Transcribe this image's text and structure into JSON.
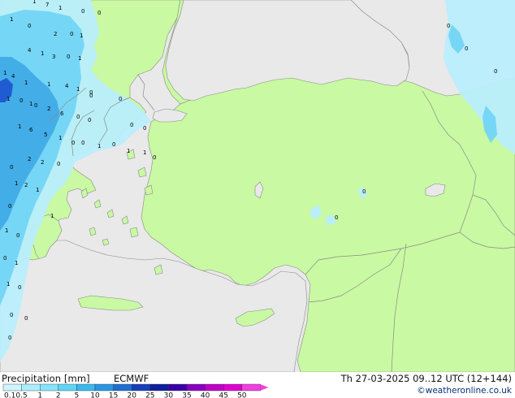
{
  "legend": {
    "title": "Precipitation [mm]",
    "model": "ECMWF",
    "valid_time": "Th 27-03-2025 09..12 UTC (12+144)",
    "credit": "©weatheronline.co.uk",
    "scale_ticks": [
      "0.1",
      "0.5",
      "1",
      "2",
      "5",
      "10",
      "15",
      "20",
      "25",
      "30",
      "35",
      "40",
      "45",
      "50"
    ],
    "scale_colors": [
      "#cff6ff",
      "#aaeeff",
      "#85e4fb",
      "#5fd4f5",
      "#3bb9ee",
      "#2a96e2",
      "#1e6fd2",
      "#163fbb",
      "#0d1f9a",
      "#3a00a8",
      "#8a00c0",
      "#c000c8",
      "#e000d0",
      "#f040e0"
    ]
  },
  "colors": {
    "sea": "#e9e9e9",
    "land": "#c9f9a2",
    "border": "#8a8a8a",
    "precip_light": "#b9eefc",
    "precip_mid": "#6fd3f5",
    "precip_heavy": "#3ea8e6",
    "precip_max": "#1f57d0"
  },
  "map": {
    "point_values": [
      {
        "text": "1"
      },
      {
        "text": "7"
      },
      {
        "text": "1"
      },
      {
        "text": "0"
      },
      {
        "text": "0"
      },
      {
        "text": "1"
      },
      {
        "text": "0"
      },
      {
        "text": "2"
      },
      {
        "text": "0"
      },
      {
        "text": "1"
      },
      {
        "text": "4"
      },
      {
        "text": "1"
      },
      {
        "text": "3"
      },
      {
        "text": "0"
      },
      {
        "text": "1"
      },
      {
        "text": "1"
      },
      {
        "text": "4"
      },
      {
        "text": "1"
      },
      {
        "text": "1"
      },
      {
        "text": "4"
      },
      {
        "text": "1"
      },
      {
        "text": "0"
      },
      {
        "text": "1"
      },
      {
        "text": "0"
      },
      {
        "text": "1"
      },
      {
        "text": "0"
      },
      {
        "text": "2"
      },
      {
        "text": "6"
      },
      {
        "text": "0"
      },
      {
        "text": "0"
      },
      {
        "text": "1"
      },
      {
        "text": "6"
      },
      {
        "text": "5"
      },
      {
        "text": "1"
      },
      {
        "text": "0"
      },
      {
        "text": "0"
      },
      {
        "text": "1"
      },
      {
        "text": "0"
      },
      {
        "text": "1"
      },
      {
        "text": "1"
      },
      {
        "text": "2"
      },
      {
        "text": "2"
      },
      {
        "text": "0"
      },
      {
        "text": "0"
      },
      {
        "text": "1"
      },
      {
        "text": "2"
      },
      {
        "text": "1"
      },
      {
        "text": "1"
      },
      {
        "text": "0"
      },
      {
        "text": "1"
      },
      {
        "text": "0"
      },
      {
        "text": "0"
      },
      {
        "text": "1"
      },
      {
        "text": "1"
      },
      {
        "text": "0"
      },
      {
        "text": "0"
      },
      {
        "text": "0"
      },
      {
        "text": "0"
      },
      {
        "text": "0"
      },
      {
        "text": "0"
      },
      {
        "text": "0"
      },
      {
        "text": "0"
      },
      {
        "text": "0"
      },
      {
        "text": "0"
      },
      {
        "text": "0"
      },
      {
        "text": "0"
      },
      {
        "text": "0"
      },
      {
        "text": "0"
      }
    ]
  }
}
